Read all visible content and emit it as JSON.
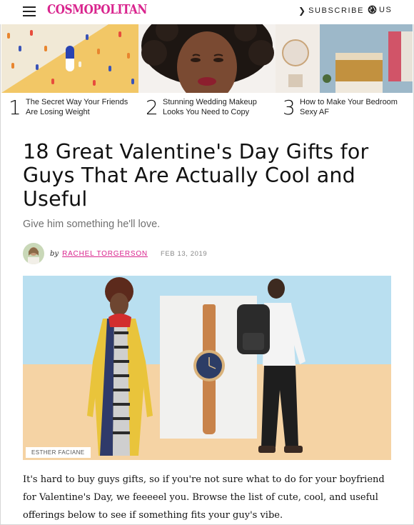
{
  "header": {
    "logo": "COSMOPOLITAN",
    "subscribe_label": "SUBSCRIBE",
    "region_label": "US",
    "brand_color": "#d9258e"
  },
  "trending": [
    {
      "rank": "1",
      "title": "The Secret Way Your Friends Are Losing Weight"
    },
    {
      "rank": "2",
      "title": "Stunning Wedding Makeup Looks You Need to Copy"
    },
    {
      "rank": "3",
      "title": "How to Make Your Bedroom Sexy AF"
    }
  ],
  "article": {
    "headline": "18 Great Valentine's Day Gifts for Guys That Are Actually Cool and Useful",
    "dek": "Give him something he'll love.",
    "byline_prefix": "by",
    "author": "RACHEL TORGERSON",
    "date": "FEB 13, 2019",
    "image_credit": "ESTHER FACIANE",
    "body": "It's hard to buy guys gifts, so if you're not sure what to do for your boyfriend for Valentine's Day, we feeeeel you. Browse the list of cute, cool, and useful offerings below to see if something fits your guy's vibe."
  },
  "icons": {
    "menu": "hamburger-icon",
    "subscribe": "chevron-right-icon",
    "region": "globe-icon"
  }
}
